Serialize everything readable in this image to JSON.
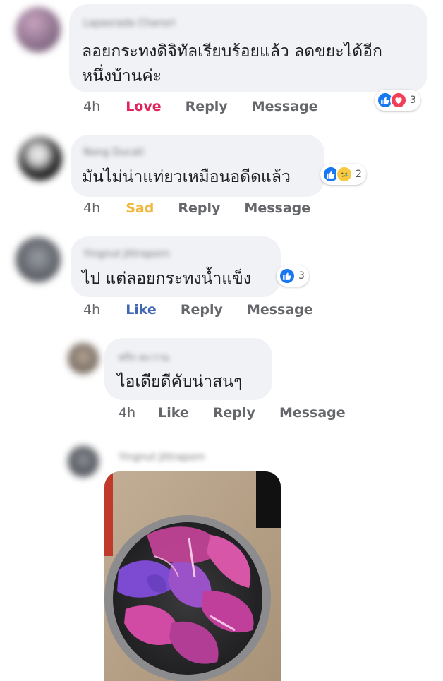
{
  "comments": [
    {
      "author": "Lapasrada Chansri",
      "text_lines": [
        "ลอยกระทงดิจิทัลเรียบร้อยแล้ว ลดขยะได้อีก",
        "หนึ่งบ้านค่ะ"
      ],
      "time": "4h",
      "reaction_action": "Love",
      "reply": "Reply",
      "message": "Message",
      "reaction_count": "3",
      "reaction_icons": [
        "like-icon",
        "love-icon"
      ]
    },
    {
      "author": "Nong Ducati",
      "text_lines": [
        "มันไม่น่าแท่ยวเหมือนอดีดแล้ว"
      ],
      "time": "4h",
      "reaction_action": "Sad",
      "reply": "Reply",
      "message": "Message",
      "reaction_count": "2",
      "reaction_icons": [
        "like-icon",
        "sad-icon"
      ]
    },
    {
      "author": "Yingnut Jittraporn",
      "text_lines": [
        "ไป แต่ลอยกระทงน้ำแข็ง"
      ],
      "time": "4h",
      "reaction_action": "Like",
      "reply": "Reply",
      "message": "Message",
      "reaction_count": "3",
      "reaction_icons": [
        "like-icon"
      ]
    }
  ],
  "reply": {
    "author": "พริก ตะวาน",
    "text_lines": [
      "ไอเดียดีคับน่าสนๆ"
    ],
    "time": "4h",
    "like": "Like",
    "reply": "Reply",
    "message": "Message"
  },
  "photo_reply": {
    "author": "Yingnut Jittraporn",
    "image": "photo of purple and pink orchid petals floating in a metal bowl"
  },
  "colors": {
    "bubble": "#f0f2f5",
    "love": "#e0245e",
    "sad": "#f0b93e",
    "like": "#4267b2",
    "meta": "#65676b"
  }
}
